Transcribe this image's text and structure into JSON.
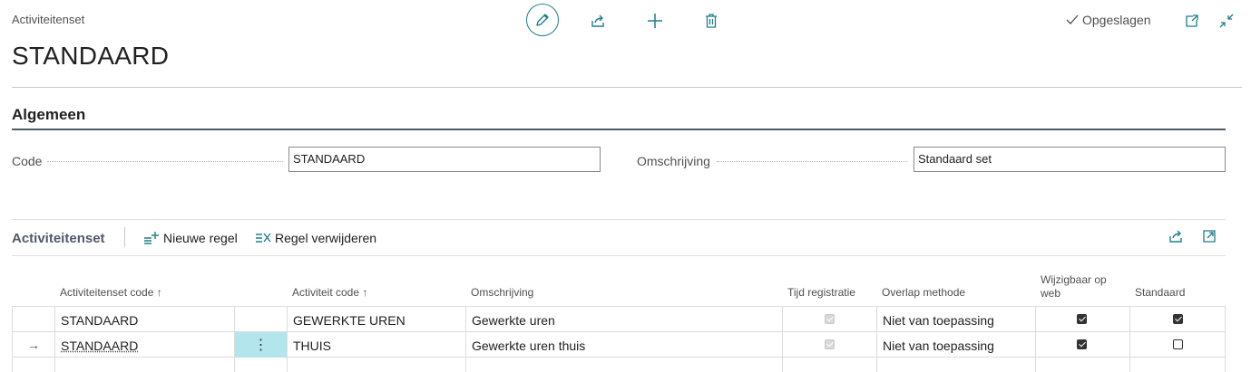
{
  "header": {
    "breadcrumb": "Activiteitenset",
    "title": "STANDAARD",
    "saved_label": "Opgeslagen"
  },
  "section": {
    "title": "Algemeen",
    "code_label": "Code",
    "code_value": "STANDAARD",
    "description_label": "Omschrijving",
    "description_value": "Standaard set"
  },
  "part": {
    "title": "Activiteitenset",
    "new_line_label": "Nieuwe regel",
    "delete_line_label": "Regel verwijderen"
  },
  "columns": {
    "set_code": "Activiteitenset code",
    "activity_code": "Activiteit code",
    "description": "Omschrijving",
    "time_registration": "Tijd registratie",
    "overlap_method": "Overlap methode",
    "editable_web": "Wijzigbaar op web",
    "standard": "Standaard"
  },
  "rows": [
    {
      "set_code": "STANDAARD",
      "activity_code": "GEWERKTE UREN",
      "description": "Gewerkte uren",
      "time_registration": true,
      "overlap_method": "Niet van toepassing",
      "editable_web": true,
      "standard": true
    },
    {
      "set_code": "STANDAARD",
      "activity_code": "THUIS",
      "description": "Gewerkte uren thuis",
      "time_registration": true,
      "overlap_method": "Niet van toepassing",
      "editable_web": true,
      "standard": false
    }
  ],
  "colors": {
    "accent": "#1f7e8c",
    "selected_cell": "#b3e5ec",
    "section_rule": "#505a69"
  },
  "icons": [
    "edit-icon",
    "share-icon",
    "add-icon",
    "delete-icon",
    "check-icon",
    "open-new-window-icon",
    "collapse-icon",
    "new-line-icon",
    "delete-line-icon",
    "row-arrow-icon",
    "more-options-icon"
  ]
}
